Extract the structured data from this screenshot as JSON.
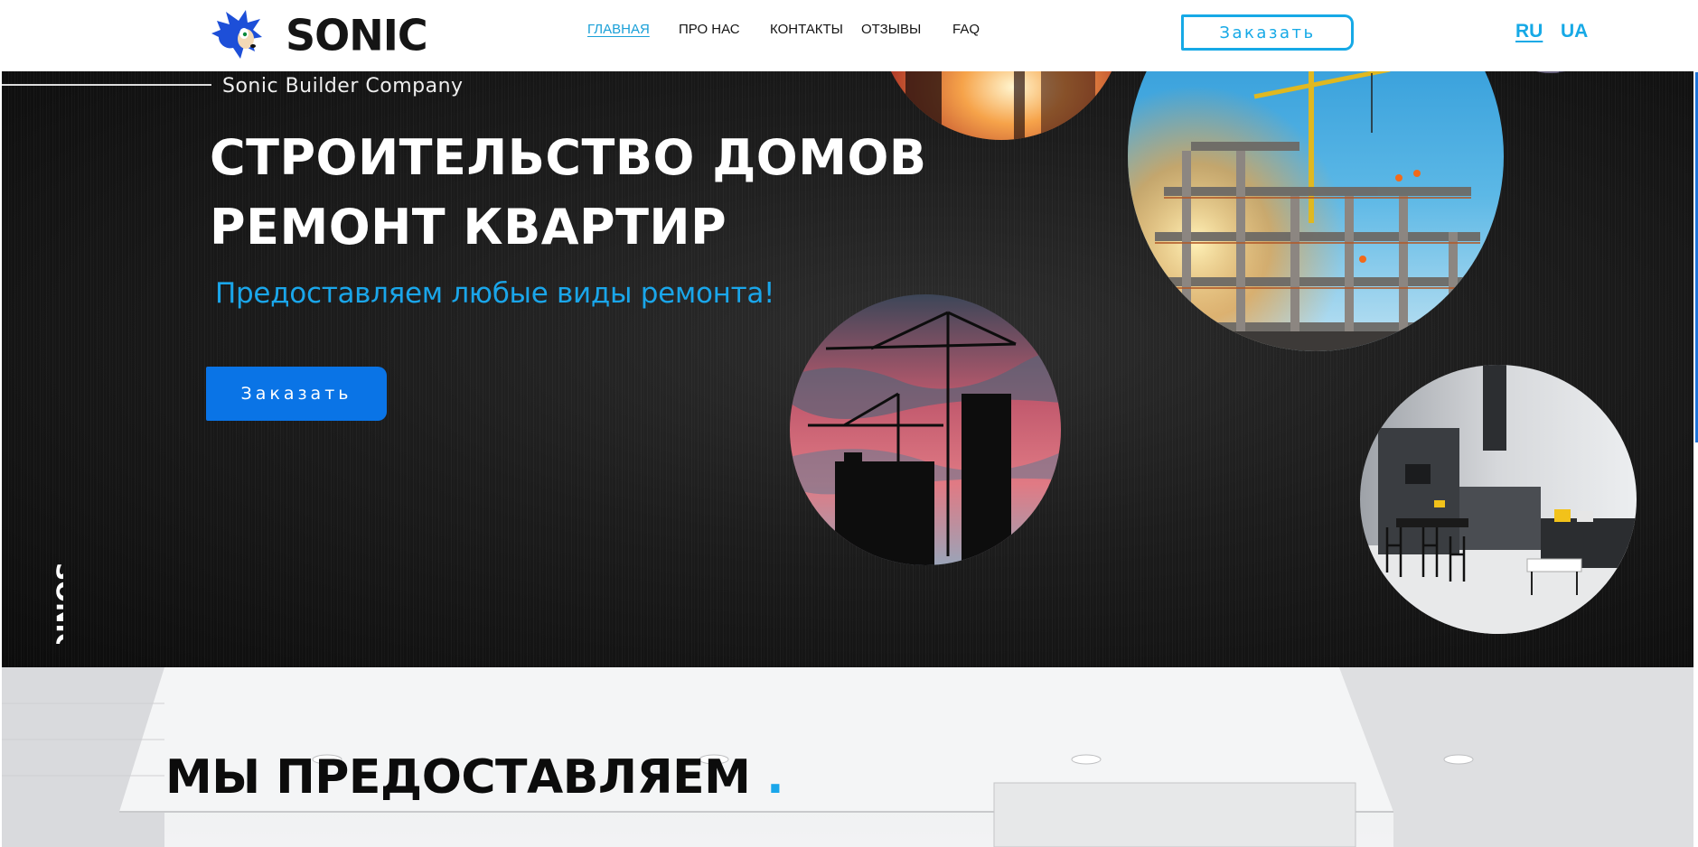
{
  "header": {
    "brand": "SONIC",
    "nav": [
      {
        "label": "ГЛАВНАЯ",
        "active": true
      },
      {
        "label": "ПРО НАС",
        "active": false
      },
      {
        "label": "КОНТАКТЫ",
        "active": false
      },
      {
        "label": "ОТЗЫВЫ",
        "active": false
      },
      {
        "label": "FAQ",
        "active": false
      }
    ],
    "order_label": "Заказать",
    "languages": [
      {
        "label": "RU",
        "active": true
      },
      {
        "label": "UA",
        "active": false
      }
    ]
  },
  "hero": {
    "company": "Sonic Builder Company",
    "title_line1": "СТРОИТЕЛЬСТВО ДОМОВ",
    "title_line2": "РЕМОНТ КВАРТИР",
    "tagline": "Предоставляем любые виды ремонта!",
    "order_label": "Заказать",
    "vertical_brand": "SONIC",
    "images": [
      "sunset-construction-photo",
      "high-rise-construction-photo",
      "crane-silhouette-photo",
      "modern-kitchen-interior-photo",
      "city-night-photo"
    ]
  },
  "services": {
    "title": "МЫ ПРЕДОСТАВЛЯЕМ",
    "dot": "."
  },
  "colors": {
    "accent": "#16a9e6",
    "button_blue": "#0a74e6",
    "hero_bg": "#1a1a1a",
    "logo_blue": "#1d4fd8"
  }
}
